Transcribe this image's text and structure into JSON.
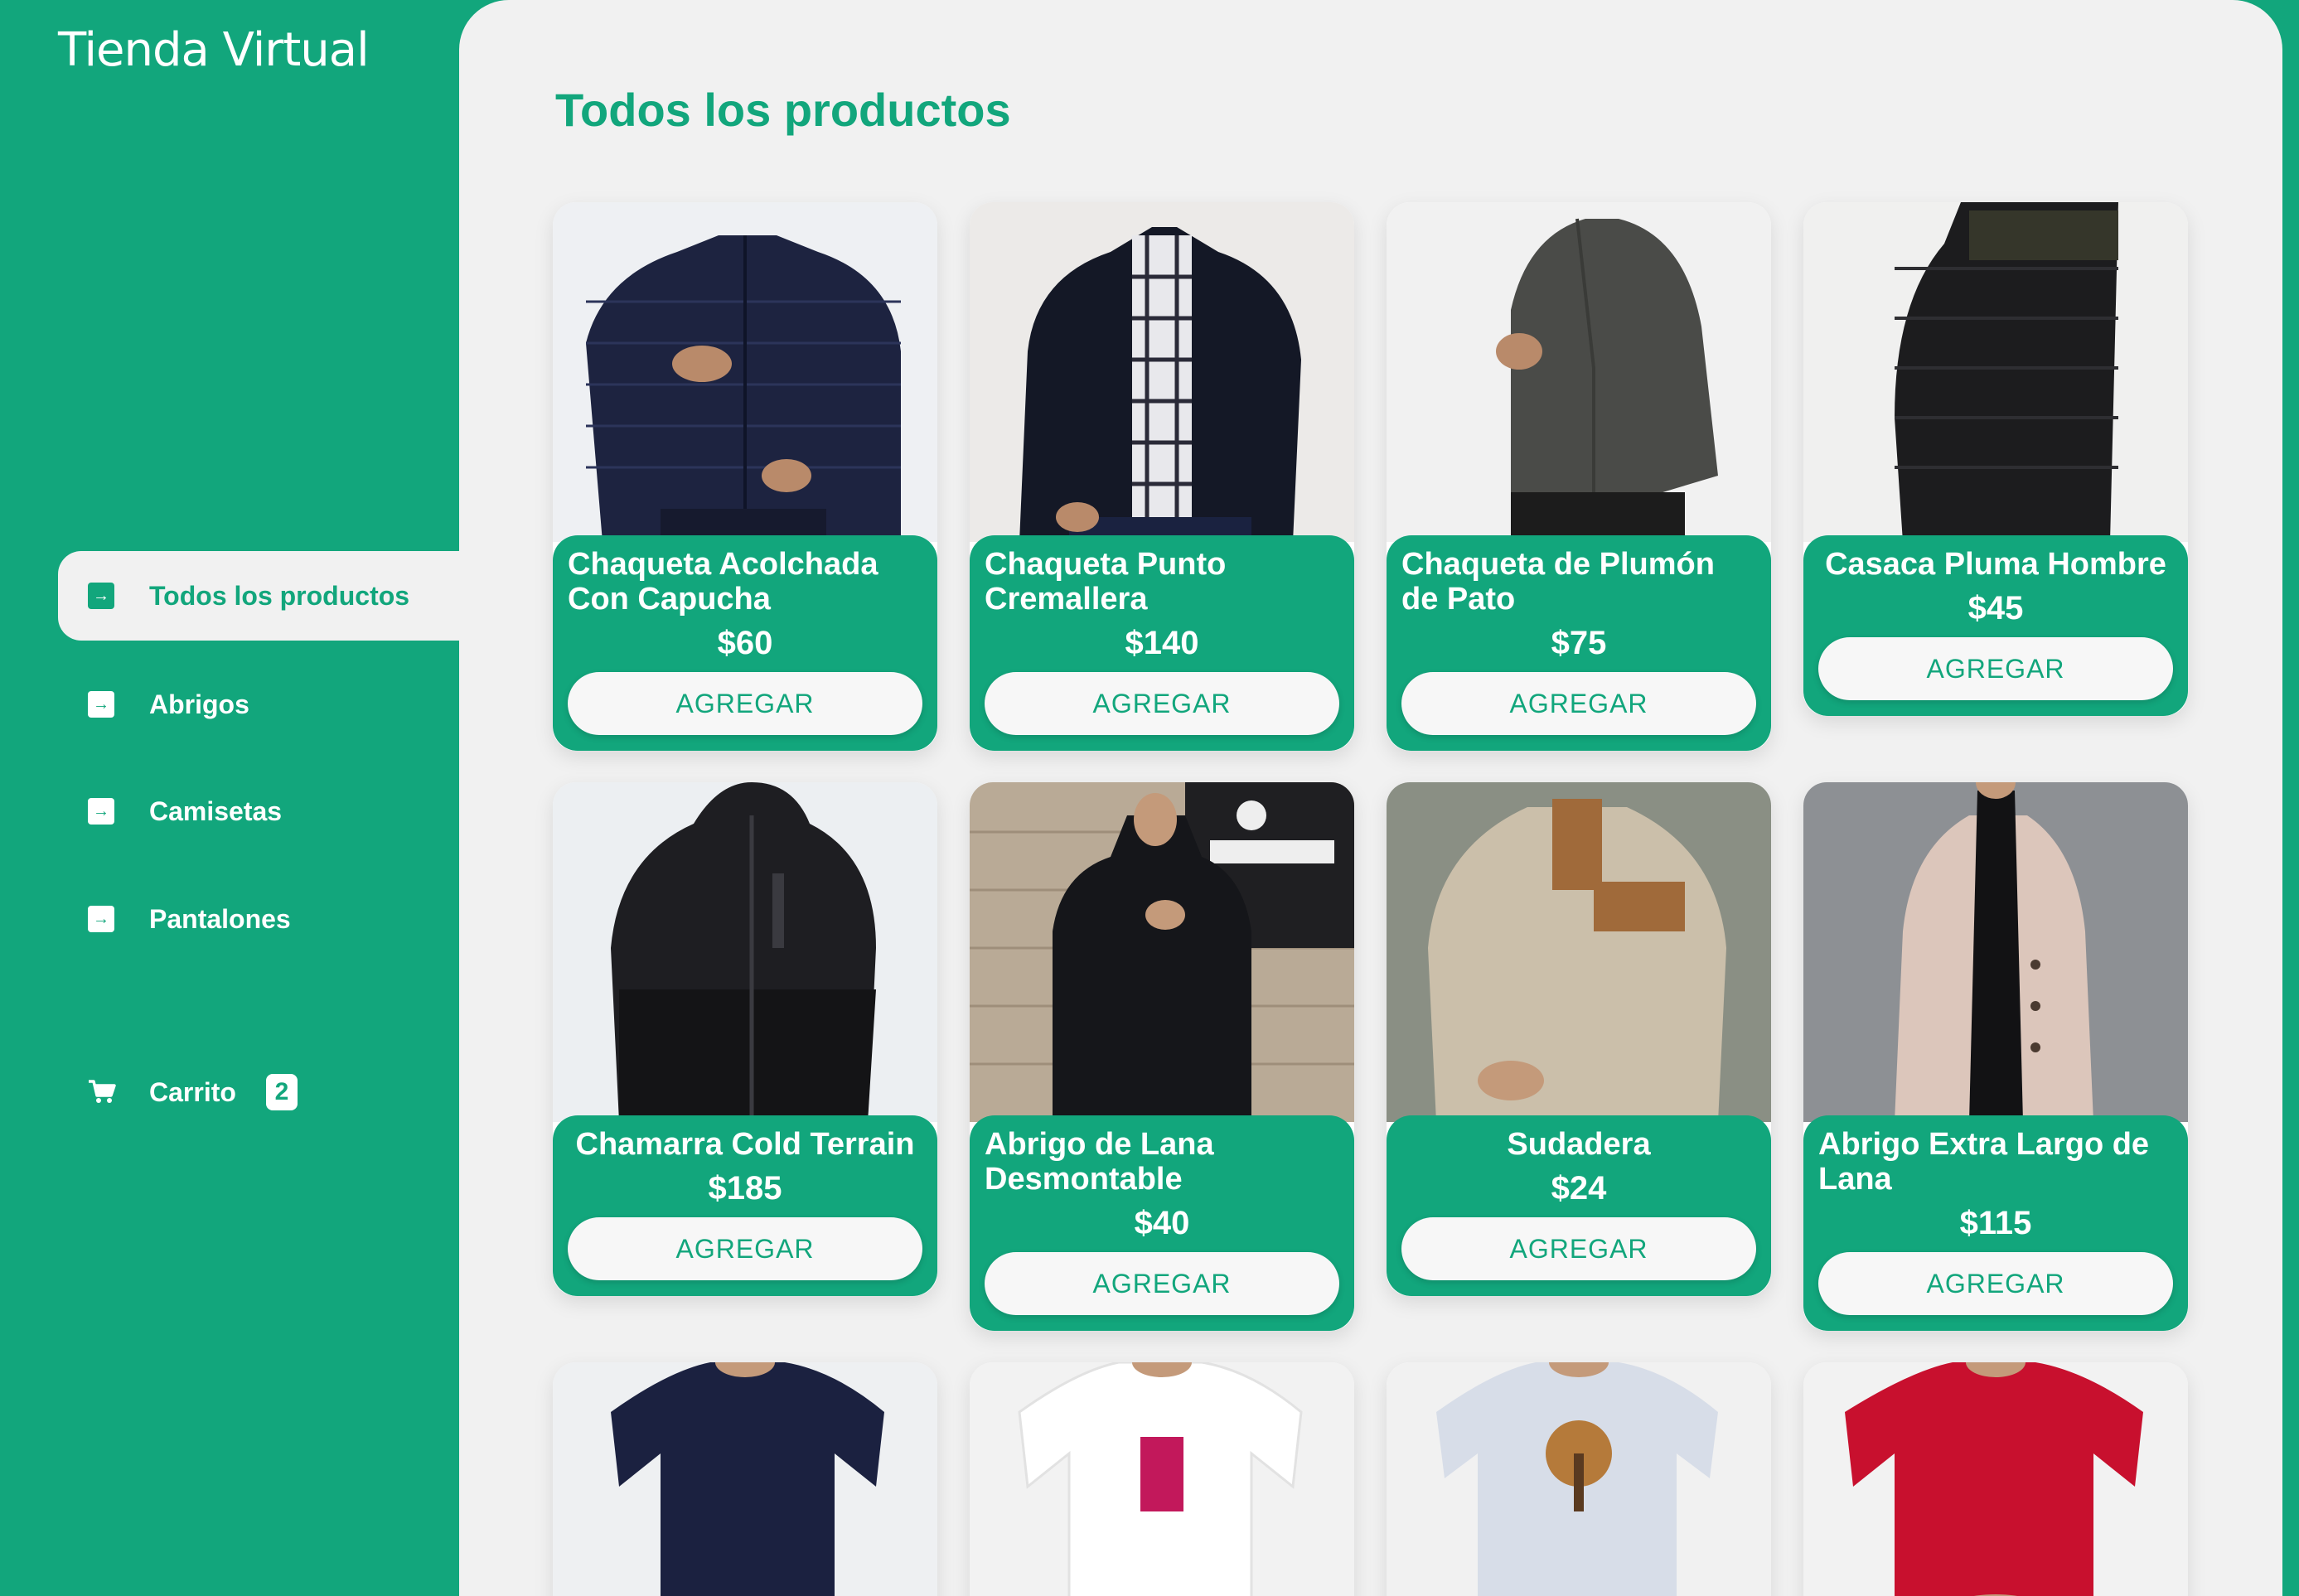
{
  "app": {
    "title": "Tienda Virtual"
  },
  "colors": {
    "brand": "#12a67c",
    "background": "#f1f1f1"
  },
  "sidebar": {
    "items": [
      {
        "label": "Todos los productos",
        "icon": "arrow-right-square-icon",
        "active": true
      },
      {
        "label": "Abrigos",
        "icon": "arrow-right-square-icon",
        "active": false
      },
      {
        "label": "Camisetas",
        "icon": "arrow-right-square-icon",
        "active": false
      },
      {
        "label": "Pantalones",
        "icon": "arrow-right-square-icon",
        "active": false
      }
    ],
    "cart": {
      "label": "Carrito",
      "count": "2",
      "icon": "cart-icon"
    }
  },
  "main": {
    "title": "Todos los productos",
    "products": [
      {
        "name": "Chaqueta Acolchada Con Capucha",
        "price": "$60",
        "button": "AGREGAR"
      },
      {
        "name": "Chaqueta Punto Cremallera",
        "price": "$140",
        "button": "AGREGAR"
      },
      {
        "name": "Chaqueta de Plumón de Pato",
        "price": "$75",
        "button": "AGREGAR"
      },
      {
        "name": "Casaca Pluma Hombre",
        "price": "$45",
        "button": "AGREGAR"
      },
      {
        "name": "Chamarra Cold Terrain",
        "price": "$185",
        "button": "AGREGAR"
      },
      {
        "name": "Abrigo de Lana Desmontable",
        "price": "$40",
        "button": "AGREGAR"
      },
      {
        "name": "Sudadera",
        "price": "$24",
        "button": "AGREGAR"
      },
      {
        "name": "Abrigo Extra Largo de Lana",
        "price": "$115",
        "button": "AGREGAR"
      }
    ]
  }
}
